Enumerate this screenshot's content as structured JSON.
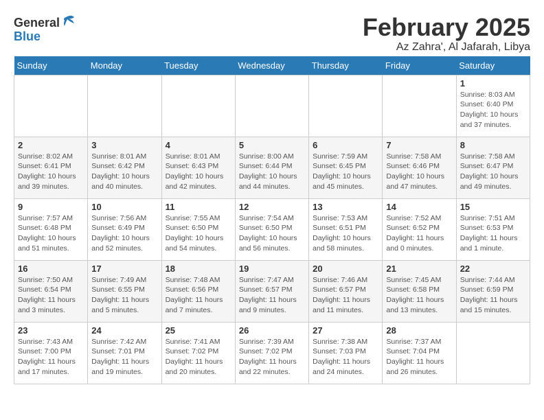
{
  "logo": {
    "text_general": "General",
    "text_blue": "Blue",
    "bird_unicode": "▲"
  },
  "header": {
    "title": "February 2025",
    "subtitle": "Az Zahra', Al Jafarah, Libya"
  },
  "weekdays": [
    "Sunday",
    "Monday",
    "Tuesday",
    "Wednesday",
    "Thursday",
    "Friday",
    "Saturday"
  ],
  "weeks": [
    [
      {
        "day": "",
        "info": ""
      },
      {
        "day": "",
        "info": ""
      },
      {
        "day": "",
        "info": ""
      },
      {
        "day": "",
        "info": ""
      },
      {
        "day": "",
        "info": ""
      },
      {
        "day": "",
        "info": ""
      },
      {
        "day": "1",
        "info": "Sunrise: 8:03 AM\nSunset: 6:40 PM\nDaylight: 10 hours and 37 minutes."
      }
    ],
    [
      {
        "day": "2",
        "info": "Sunrise: 8:02 AM\nSunset: 6:41 PM\nDaylight: 10 hours and 39 minutes."
      },
      {
        "day": "3",
        "info": "Sunrise: 8:01 AM\nSunset: 6:42 PM\nDaylight: 10 hours and 40 minutes."
      },
      {
        "day": "4",
        "info": "Sunrise: 8:01 AM\nSunset: 6:43 PM\nDaylight: 10 hours and 42 minutes."
      },
      {
        "day": "5",
        "info": "Sunrise: 8:00 AM\nSunset: 6:44 PM\nDaylight: 10 hours and 44 minutes."
      },
      {
        "day": "6",
        "info": "Sunrise: 7:59 AM\nSunset: 6:45 PM\nDaylight: 10 hours and 45 minutes."
      },
      {
        "day": "7",
        "info": "Sunrise: 7:58 AM\nSunset: 6:46 PM\nDaylight: 10 hours and 47 minutes."
      },
      {
        "day": "8",
        "info": "Sunrise: 7:58 AM\nSunset: 6:47 PM\nDaylight: 10 hours and 49 minutes."
      }
    ],
    [
      {
        "day": "9",
        "info": "Sunrise: 7:57 AM\nSunset: 6:48 PM\nDaylight: 10 hours and 51 minutes."
      },
      {
        "day": "10",
        "info": "Sunrise: 7:56 AM\nSunset: 6:49 PM\nDaylight: 10 hours and 52 minutes."
      },
      {
        "day": "11",
        "info": "Sunrise: 7:55 AM\nSunset: 6:50 PM\nDaylight: 10 hours and 54 minutes."
      },
      {
        "day": "12",
        "info": "Sunrise: 7:54 AM\nSunset: 6:50 PM\nDaylight: 10 hours and 56 minutes."
      },
      {
        "day": "13",
        "info": "Sunrise: 7:53 AM\nSunset: 6:51 PM\nDaylight: 10 hours and 58 minutes."
      },
      {
        "day": "14",
        "info": "Sunrise: 7:52 AM\nSunset: 6:52 PM\nDaylight: 11 hours and 0 minutes."
      },
      {
        "day": "15",
        "info": "Sunrise: 7:51 AM\nSunset: 6:53 PM\nDaylight: 11 hours and 1 minute."
      }
    ],
    [
      {
        "day": "16",
        "info": "Sunrise: 7:50 AM\nSunset: 6:54 PM\nDaylight: 11 hours and 3 minutes."
      },
      {
        "day": "17",
        "info": "Sunrise: 7:49 AM\nSunset: 6:55 PM\nDaylight: 11 hours and 5 minutes."
      },
      {
        "day": "18",
        "info": "Sunrise: 7:48 AM\nSunset: 6:56 PM\nDaylight: 11 hours and 7 minutes."
      },
      {
        "day": "19",
        "info": "Sunrise: 7:47 AM\nSunset: 6:57 PM\nDaylight: 11 hours and 9 minutes."
      },
      {
        "day": "20",
        "info": "Sunrise: 7:46 AM\nSunset: 6:57 PM\nDaylight: 11 hours and 11 minutes."
      },
      {
        "day": "21",
        "info": "Sunrise: 7:45 AM\nSunset: 6:58 PM\nDaylight: 11 hours and 13 minutes."
      },
      {
        "day": "22",
        "info": "Sunrise: 7:44 AM\nSunset: 6:59 PM\nDaylight: 11 hours and 15 minutes."
      }
    ],
    [
      {
        "day": "23",
        "info": "Sunrise: 7:43 AM\nSunset: 7:00 PM\nDaylight: 11 hours and 17 minutes."
      },
      {
        "day": "24",
        "info": "Sunrise: 7:42 AM\nSunset: 7:01 PM\nDaylight: 11 hours and 19 minutes."
      },
      {
        "day": "25",
        "info": "Sunrise: 7:41 AM\nSunset: 7:02 PM\nDaylight: 11 hours and 20 minutes."
      },
      {
        "day": "26",
        "info": "Sunrise: 7:39 AM\nSunset: 7:02 PM\nDaylight: 11 hours and 22 minutes."
      },
      {
        "day": "27",
        "info": "Sunrise: 7:38 AM\nSunset: 7:03 PM\nDaylight: 11 hours and 24 minutes."
      },
      {
        "day": "28",
        "info": "Sunrise: 7:37 AM\nSunset: 7:04 PM\nDaylight: 11 hours and 26 minutes."
      },
      {
        "day": "",
        "info": ""
      }
    ]
  ]
}
